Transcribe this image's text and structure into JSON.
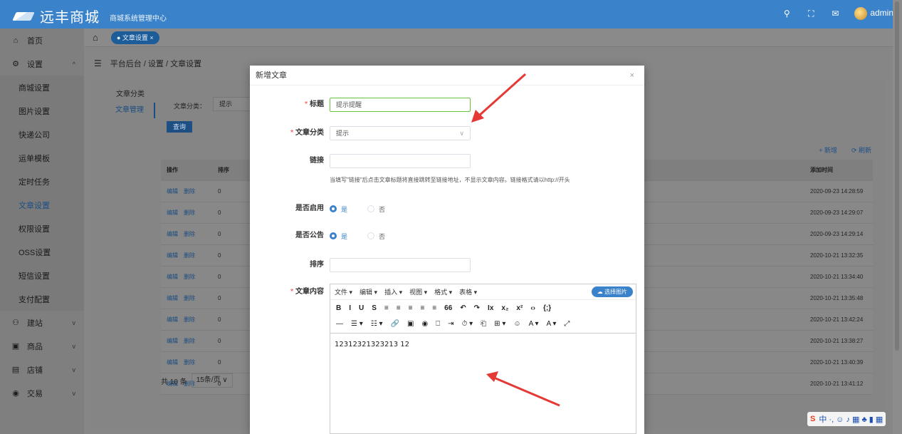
{
  "header": {
    "brand": "远丰商城",
    "subtitle": "商城系统管理中心",
    "user": "admin"
  },
  "sidebar": {
    "items": [
      {
        "label": "首页",
        "icon": "⌂"
      },
      {
        "label": "设置",
        "icon": "⚙",
        "chev": "^"
      },
      {
        "label": "建站",
        "icon": "⚇",
        "chev": "v"
      },
      {
        "label": "商品",
        "icon": "▣",
        "chev": "v"
      },
      {
        "label": "店铺",
        "icon": "▤",
        "chev": "v"
      },
      {
        "label": "交易",
        "icon": "◉",
        "chev": "v"
      }
    ],
    "subitems": [
      "商城设置",
      "图片设置",
      "快递公司",
      "运单模板",
      "定时任务",
      "文章设置",
      "权限设置",
      "OSS设置",
      "短信设置",
      "支付配置"
    ]
  },
  "tabs": {
    "active": "● 文章设置 ×"
  },
  "breadcrumb": {
    "text": "平台后台 / 设置 / 文章设置"
  },
  "subnav": [
    "文章分类",
    "文章管理"
  ],
  "filter": {
    "label": "文章分类：",
    "value": "提示",
    "query": "查询"
  },
  "actions": {
    "add": "+ 新增",
    "refresh": "⟳ 刷新"
  },
  "table": {
    "headers": {
      "op": "操作",
      "sort": "排序",
      "time": "添加时间"
    },
    "edit": "编辑",
    "del": "删除",
    "rows": [
      {
        "sort": "0",
        "time": "2020-09-23 14:28:59"
      },
      {
        "sort": "0",
        "time": "2020-09-23 14:29:07"
      },
      {
        "sort": "0",
        "time": "2020-09-23 14:29:14"
      },
      {
        "sort": "0",
        "time": "2020-10-21 13:32:35"
      },
      {
        "sort": "0",
        "time": "2020-10-21 13:34:40"
      },
      {
        "sort": "0",
        "time": "2020-10-21 13:35:48"
      },
      {
        "sort": "0",
        "time": "2020-10-21 13:42:24"
      },
      {
        "sort": "0",
        "time": "2020-10-21 13:38:27"
      },
      {
        "sort": "0",
        "time": "2020-10-21 13:40:39"
      },
      {
        "sort": "0",
        "time": "2020-10-21 13:41:12"
      }
    ]
  },
  "pager": {
    "total": "共 10 条",
    "size": "15条/页 ∨"
  },
  "modal": {
    "title": "新增文章",
    "close": "×",
    "fields": {
      "title": {
        "label": "标题",
        "value": "提示提醒"
      },
      "category": {
        "label": "文章分类",
        "value": "提示"
      },
      "link": {
        "label": "链接",
        "value": ""
      },
      "hint": "当填写\"链接\"后点击文章标题将直接跳转至链接地址，不显示文章内容。链接格式请以http://开头",
      "enabled": {
        "label": "是否启用",
        "yes": "是",
        "no": "否"
      },
      "notice": {
        "label": "是否公告",
        "yes": "是",
        "no": "否"
      },
      "sort": {
        "label": "排序",
        "value": ""
      },
      "content": {
        "label": "文章内容"
      }
    },
    "editor": {
      "menus": [
        "文件 ▾",
        "编辑 ▾",
        "插入 ▾",
        "视图 ▾",
        "格式 ▾",
        "表格 ▾"
      ],
      "pick_image": "☁ 选择图片",
      "toolbar1": [
        "B",
        "I",
        "U",
        "S",
        "≡",
        "≡",
        "≡",
        "≡",
        "≡",
        "66",
        "↶",
        "↷",
        "Ix",
        "x₂",
        "x²",
        "‹›",
        "{;}"
      ],
      "toolbar2": [
        "—",
        "☰ ▾",
        "☷ ▾",
        "🔗",
        "▣",
        "◉",
        "⎕",
        "⇥",
        "⏱ ▾",
        "⎗",
        "⊞ ▾",
        "☺",
        "A ▾",
        "A ▾",
        "⤢"
      ],
      "content": "12312321323213 12"
    }
  },
  "ime": {
    "s": "S",
    "items": "中 ·, ☺ ♪ ▦ ♣ ▮ ▦"
  },
  "colors": {
    "brand": "#3a82c9",
    "required": "#f56c6c",
    "arrow": "#e53935"
  }
}
